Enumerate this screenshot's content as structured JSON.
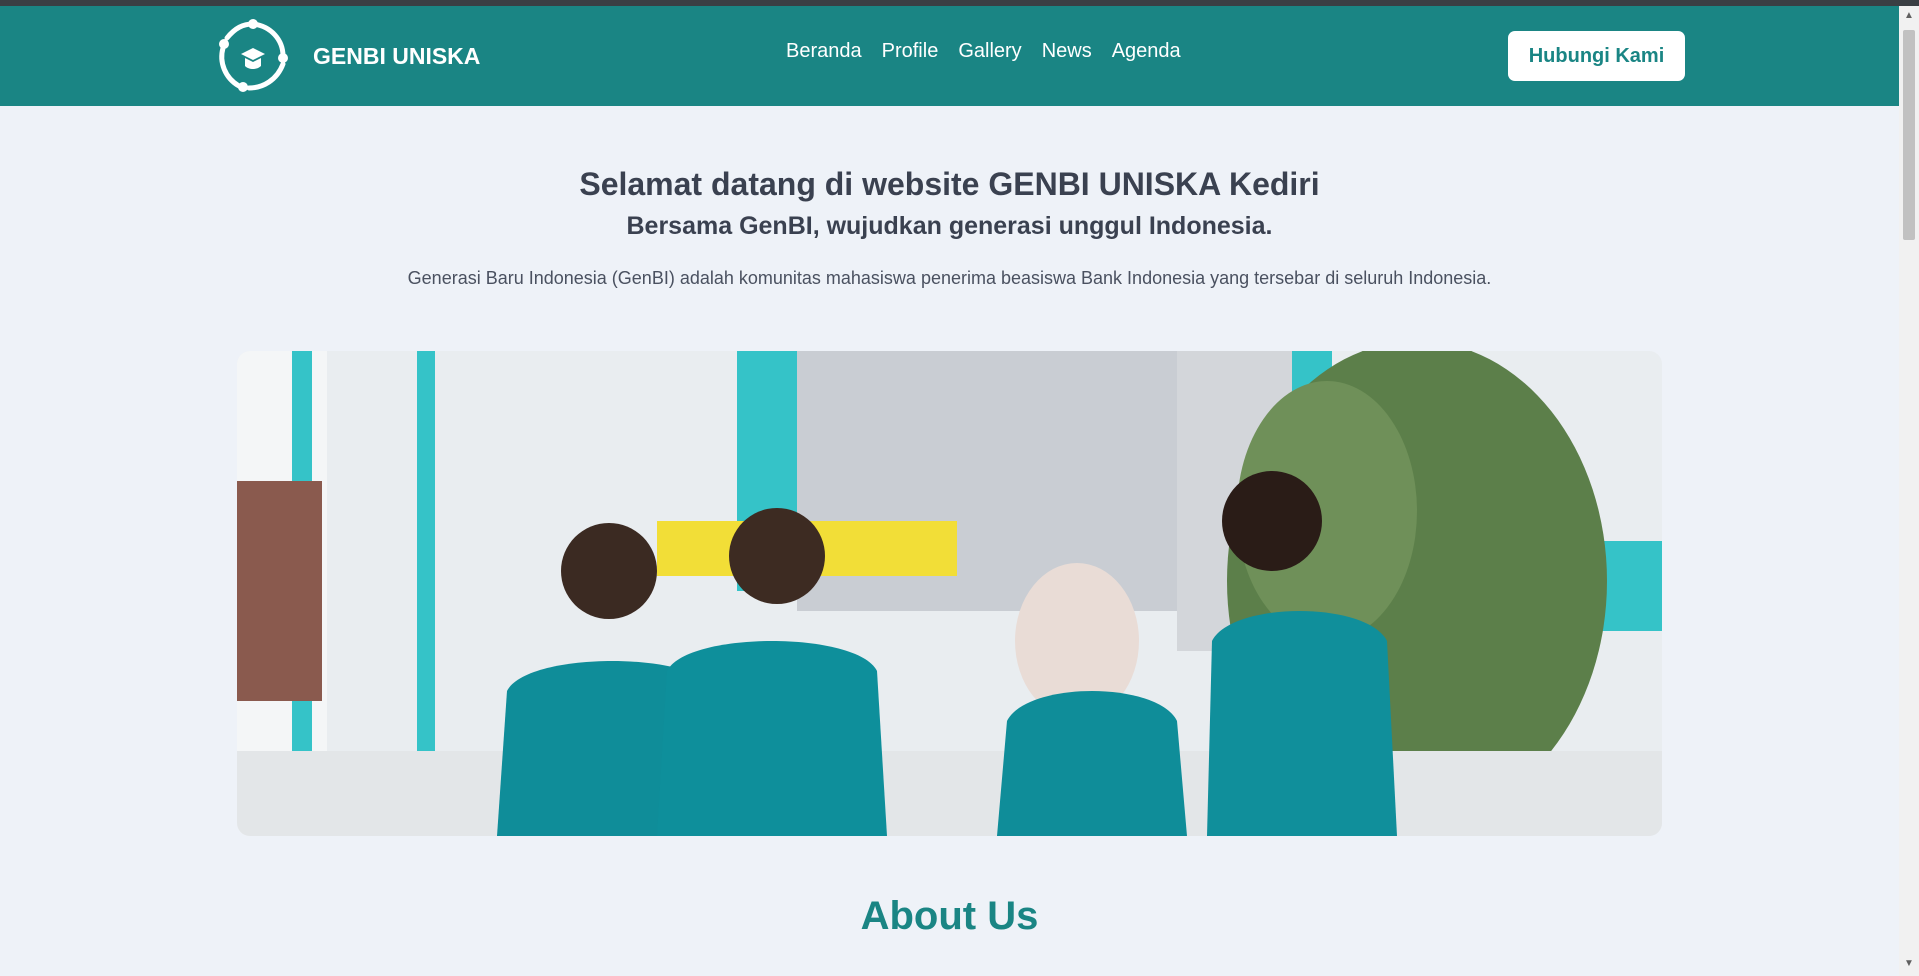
{
  "brand": {
    "name": "GENBI UNISKA",
    "logo_icon": "genbi-logo-icon"
  },
  "nav": {
    "links": [
      {
        "label": "Beranda"
      },
      {
        "label": "Profile"
      },
      {
        "label": "Gallery"
      },
      {
        "label": "News"
      },
      {
        "label": "Agenda"
      }
    ],
    "cta_label": "Hubungi Kami"
  },
  "hero": {
    "title": "Selamat datang di website GENBI UNISKA Kediri",
    "subtitle": "Bersama GenBI, wujudkan generasi unggul Indonesia.",
    "description": "Generasi Baru Indonesia (GenBI) adalah komunitas mahasiswa penerima beasiswa Bank Indonesia yang tersebar di seluruh Indonesia."
  },
  "about": {
    "title": "About Us"
  },
  "colors": {
    "brand": "#1a8584",
    "background": "#eef2f8",
    "text": "#3a4150"
  }
}
